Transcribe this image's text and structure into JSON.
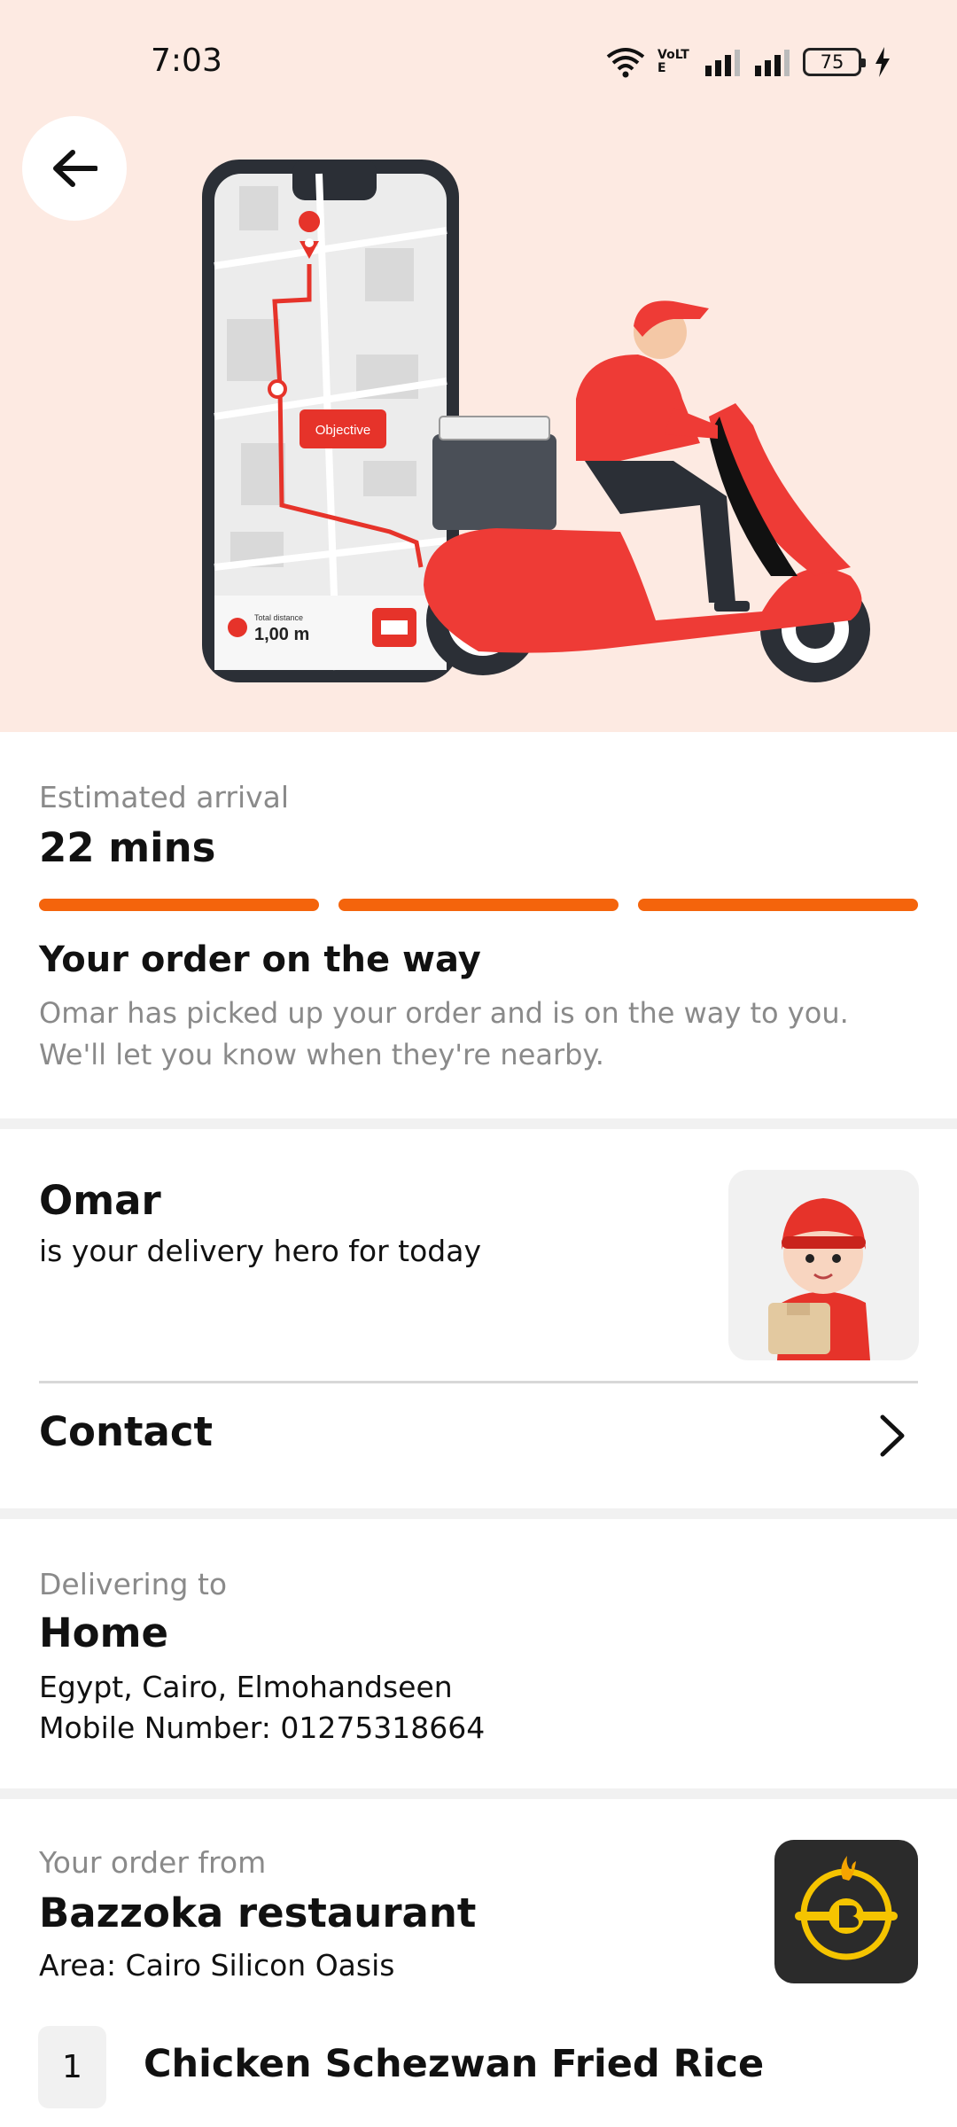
{
  "status_bar": {
    "time": "7:03",
    "battery": "75",
    "network": "VoLTE"
  },
  "illustration": {
    "objective_label": "Objective",
    "distance_caption": "Total distance",
    "distance_value": "1,00 m"
  },
  "arrival": {
    "label": "Estimated arrival",
    "time": "22 mins",
    "progress_steps_complete": 3,
    "progress_steps_total": 3,
    "status_title": "Your order on the way",
    "status_line1": "Omar has picked up your order and is on the way to you.",
    "status_line2": "We'll let you know when they're nearby."
  },
  "courier": {
    "name": "Omar",
    "subtitle": "is your delivery hero for today",
    "contact_label": "Contact"
  },
  "delivery": {
    "label": "Delivering to",
    "place": "Home",
    "address": "Egypt, Cairo, Elmohandseen",
    "phone": "Mobile Number: 01275318664"
  },
  "order": {
    "label": "Your order from",
    "restaurant": "Bazzoka restaurant",
    "area": "Area: Cairo Silicon Oasis",
    "items": [
      {
        "qty": "1",
        "name": "Chicken Schezwan Fried Rice"
      }
    ]
  },
  "colors": {
    "accent": "#f4640c",
    "hero_bg": "#fdeae2",
    "scooter": "#ee3b36"
  }
}
